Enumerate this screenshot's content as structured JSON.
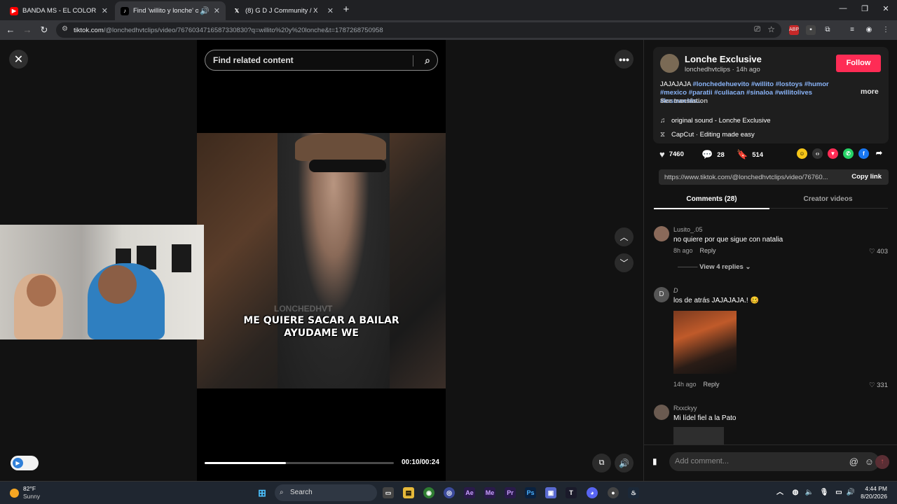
{
  "browser": {
    "tabs": [
      {
        "title": "BANDA MS - EL COLOR DE TUS",
        "icon": "youtube-icon",
        "active": false
      },
      {
        "title": "Find 'willito y lonche' on TikTok",
        "icon": "tiktok-icon",
        "active": true
      },
      {
        "title": "(8) G D J Community / X",
        "icon": "x-icon",
        "active": false
      }
    ],
    "url_domain": "tiktok.com",
    "url_path": "/@lonchedhvtclips/video/7676034716587330830?q=willito%20y%20lonche&t=1787268750958"
  },
  "player": {
    "search_placeholder": "Find related content",
    "caption_line1": "ME QUIERE SACAR A BAILAR",
    "caption_line2": "AYUDAME WE",
    "watermark": "LONCHEDHVT",
    "time": "00:10/00:24",
    "progress_fraction": 0.43
  },
  "post": {
    "author_name": "Lonche Exclusive",
    "author_handle": "lonchedhvtclips",
    "posted_ago": "14h ago",
    "handle_line": "lonchedhvtclips · 14h ago",
    "follow_label": "Follow",
    "desc_prefix": "JAJAJAJA ",
    "desc_tags_line1": "#lonchedehuevito #willito #lostoys #humor",
    "desc_tags_line2": "#mexico #paratii #culiacan #sinaloa #willitolives #losmochis...",
    "more_label": "more",
    "see_translation": "See translation",
    "sound": "original sound - Lonche Exclusive",
    "capcut": "CapCut · Editing made easy",
    "likes": "7460",
    "comments": "28",
    "saves": "514",
    "link": "https://www.tiktok.com/@lonchedhvtclips/video/76760...",
    "copy_link_label": "Copy link"
  },
  "tabs": {
    "comments_label": "Comments (28)",
    "creator_label": "Creator videos"
  },
  "comments": [
    {
      "user": "Lusito_.05",
      "text": "no quiere por que sigue con natalia",
      "ago": "8h ago",
      "reply": "Reply",
      "likes": "403",
      "replies_label": "View 4 replies"
    },
    {
      "user": "D",
      "text": "los de atrás JAJAJAJA.! 🥴",
      "ago": "14h ago",
      "reply": "Reply",
      "likes": "331"
    },
    {
      "user": "Rxxckyy",
      "text": "Mi lídel fiel a la Pato"
    }
  ],
  "add_comment_placeholder": "Add comment...",
  "taskbar": {
    "weather_temp": "82°F",
    "weather_desc": "Sunny",
    "search_label": "Search",
    "time": "4:44 PM",
    "date": "8/20/2026"
  },
  "colors": {
    "follow": "#fe2c55",
    "hashtag": "#8ab4f8",
    "background": "#121212"
  }
}
